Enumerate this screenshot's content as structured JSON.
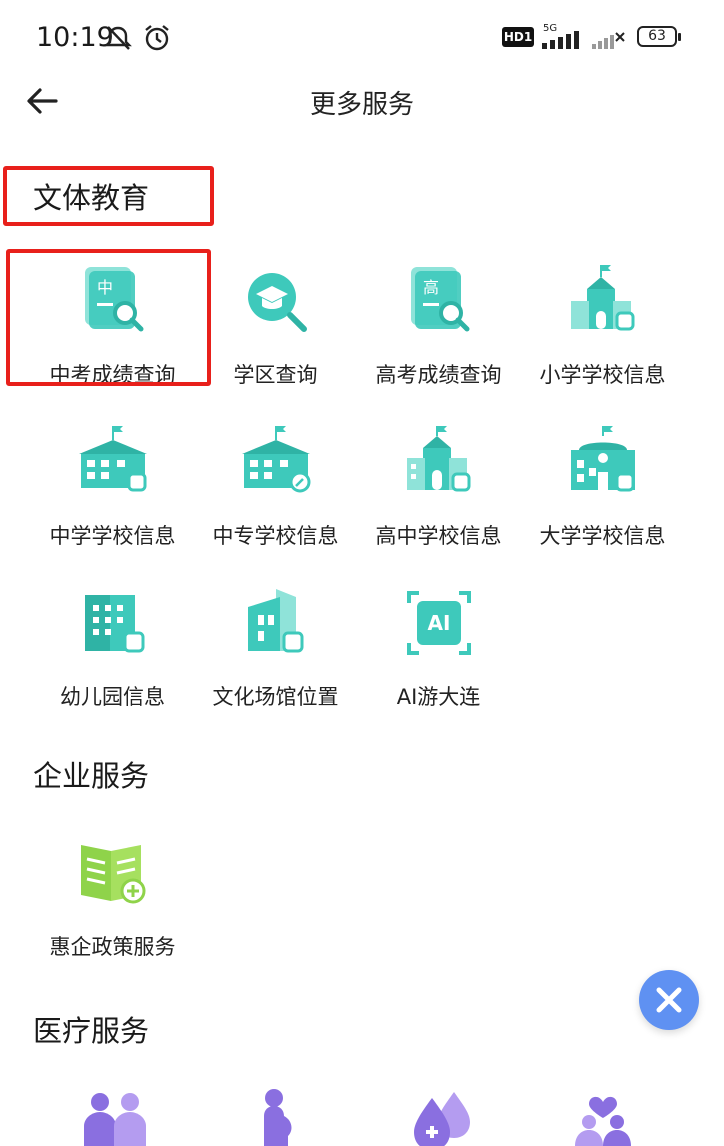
{
  "status_bar": {
    "time": "10:19",
    "network_badge": "HD1",
    "signal_label": "5G",
    "battery": "63"
  },
  "header": {
    "title": "更多服务"
  },
  "sections": [
    {
      "title": "文体教育",
      "items": [
        {
          "label": "中考成绩查询",
          "icon": "zhongkao-score-icon",
          "glyph": "中"
        },
        {
          "label": "学区查询",
          "icon": "school-district-search-icon"
        },
        {
          "label": "高考成绩查询",
          "icon": "gaokao-score-icon",
          "glyph": "高"
        },
        {
          "label": "小学学校信息",
          "icon": "primary-school-icon"
        },
        {
          "label": "中学学校信息",
          "icon": "middle-school-icon"
        },
        {
          "label": "中专学校信息",
          "icon": "vocational-school-icon"
        },
        {
          "label": "高中学校信息",
          "icon": "high-school-icon"
        },
        {
          "label": "大学学校信息",
          "icon": "university-icon"
        },
        {
          "label": "幼儿园信息",
          "icon": "kindergarten-icon"
        },
        {
          "label": "文化场馆位置",
          "icon": "cultural-venue-icon"
        },
        {
          "label": "AI游大连",
          "icon": "ai-travel-icon",
          "glyph": "AI"
        }
      ]
    },
    {
      "title": "企业服务",
      "items": [
        {
          "label": "惠企政策服务",
          "icon": "enterprise-policy-book-icon"
        }
      ]
    },
    {
      "title": "医疗服务",
      "items": [
        {
          "label": "",
          "icon": "doctor-patient-icon"
        },
        {
          "label": "",
          "icon": "pregnant-woman-icon"
        },
        {
          "label": "",
          "icon": "blood-drop-icon"
        },
        {
          "label": "",
          "icon": "family-care-icon"
        }
      ]
    }
  ],
  "colors": {
    "icon_teal": "#3ec9bb",
    "icon_teal_light": "#8fe3d9",
    "icon_green": "#8fd34a",
    "icon_purple": "#8a6fe0",
    "highlight_red": "#e8201b",
    "fab_blue": "#5f91f2"
  }
}
